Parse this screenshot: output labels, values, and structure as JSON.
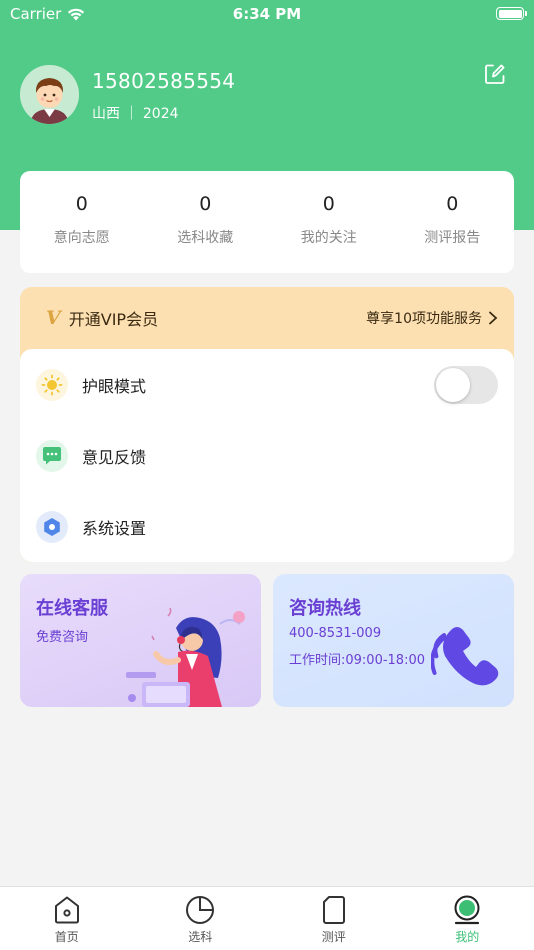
{
  "status_bar": {
    "carrier": "Carrier",
    "time": "6:34 PM"
  },
  "profile": {
    "phone": "15802585554",
    "region": "山西 ｜ 2024"
  },
  "stats": [
    {
      "value": "0",
      "label": "意向志愿"
    },
    {
      "value": "0",
      "label": "选科收藏"
    },
    {
      "value": "0",
      "label": "我的关注"
    },
    {
      "value": "0",
      "label": "测评报告"
    }
  ],
  "vip": {
    "badge": "V",
    "title": "开通VIP会员",
    "desc": "尊享10项功能服务"
  },
  "menu": [
    {
      "label": "护眼模式",
      "icon": "sun-icon",
      "toggle_on": false
    },
    {
      "label": "意见反馈",
      "icon": "feedback-icon"
    },
    {
      "label": "系统设置",
      "icon": "settings-icon"
    }
  ],
  "services": {
    "online": {
      "title": "在线客服",
      "subtitle": "免费咨询"
    },
    "hotline": {
      "title": "咨询热线",
      "phone": "400-8531-009",
      "hours": "工作时间:09:00-18:00"
    }
  },
  "tabs": [
    {
      "label": "首页",
      "icon": "home-icon"
    },
    {
      "label": "选科",
      "icon": "pie-icon"
    },
    {
      "label": "测评",
      "icon": "card-icon"
    },
    {
      "label": "我的",
      "icon": "profile-icon",
      "active": true
    }
  ],
  "colors": {
    "brand_green": "#52cb88",
    "vip_bg": "#fde0b2",
    "purple": "#6a3fd3"
  }
}
